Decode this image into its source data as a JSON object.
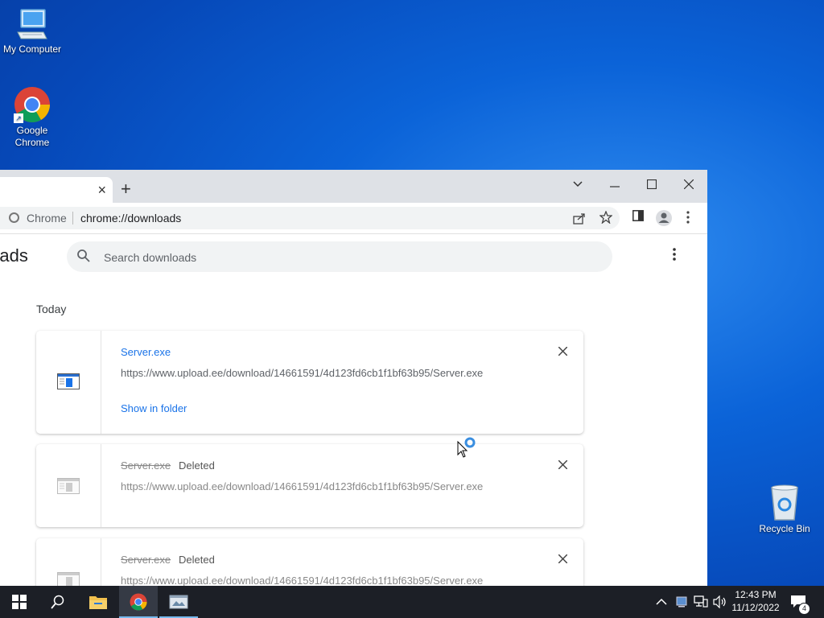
{
  "desktop": {
    "icons": [
      {
        "label": "My Computer"
      },
      {
        "label": "Google Chrome"
      },
      {
        "label": "Recycle Bin"
      }
    ]
  },
  "chrome": {
    "tab_close": "×",
    "new_tab": "+",
    "window_controls": {
      "minimize": "—",
      "maximize": "☐",
      "close": "✕",
      "dropdown": "⌄"
    },
    "omnibox": {
      "site_name": "Chrome",
      "url": "chrome://downloads"
    },
    "toolbar_icons": [
      "share-icon",
      "bookmark-star-icon",
      "side-panel-icon",
      "profile-icon",
      "menu-icon"
    ]
  },
  "downloads_page": {
    "title": "nloads",
    "search": {
      "placeholder": "Search downloads"
    },
    "section_label": "Today",
    "items": [
      {
        "filename": "Server.exe",
        "status": "",
        "url": "https://www.upload.ee/download/14661591/4d123fd6cb1f1bf63b95/Server.exe",
        "action": "Show in folder",
        "state": "complete"
      },
      {
        "filename": "Server.exe",
        "status": "Deleted",
        "url": "https://www.upload.ee/download/14661591/4d123fd6cb1f1bf63b95/Server.exe",
        "state": "deleted"
      },
      {
        "filename": "Server.exe",
        "status": "Deleted",
        "url": "https://www.upload.ee/download/14661591/4d123fd6cb1f1bf63b95/Server.exe",
        "state": "deleted"
      }
    ]
  },
  "taskbar": {
    "clock": {
      "time": "12:43 PM",
      "date": "11/12/2022"
    },
    "notification_count": "4"
  },
  "colors": {
    "accent_blue": "#1a73e8",
    "taskbar": "#1c1f26",
    "desktop_blue": "#0b63d8"
  }
}
